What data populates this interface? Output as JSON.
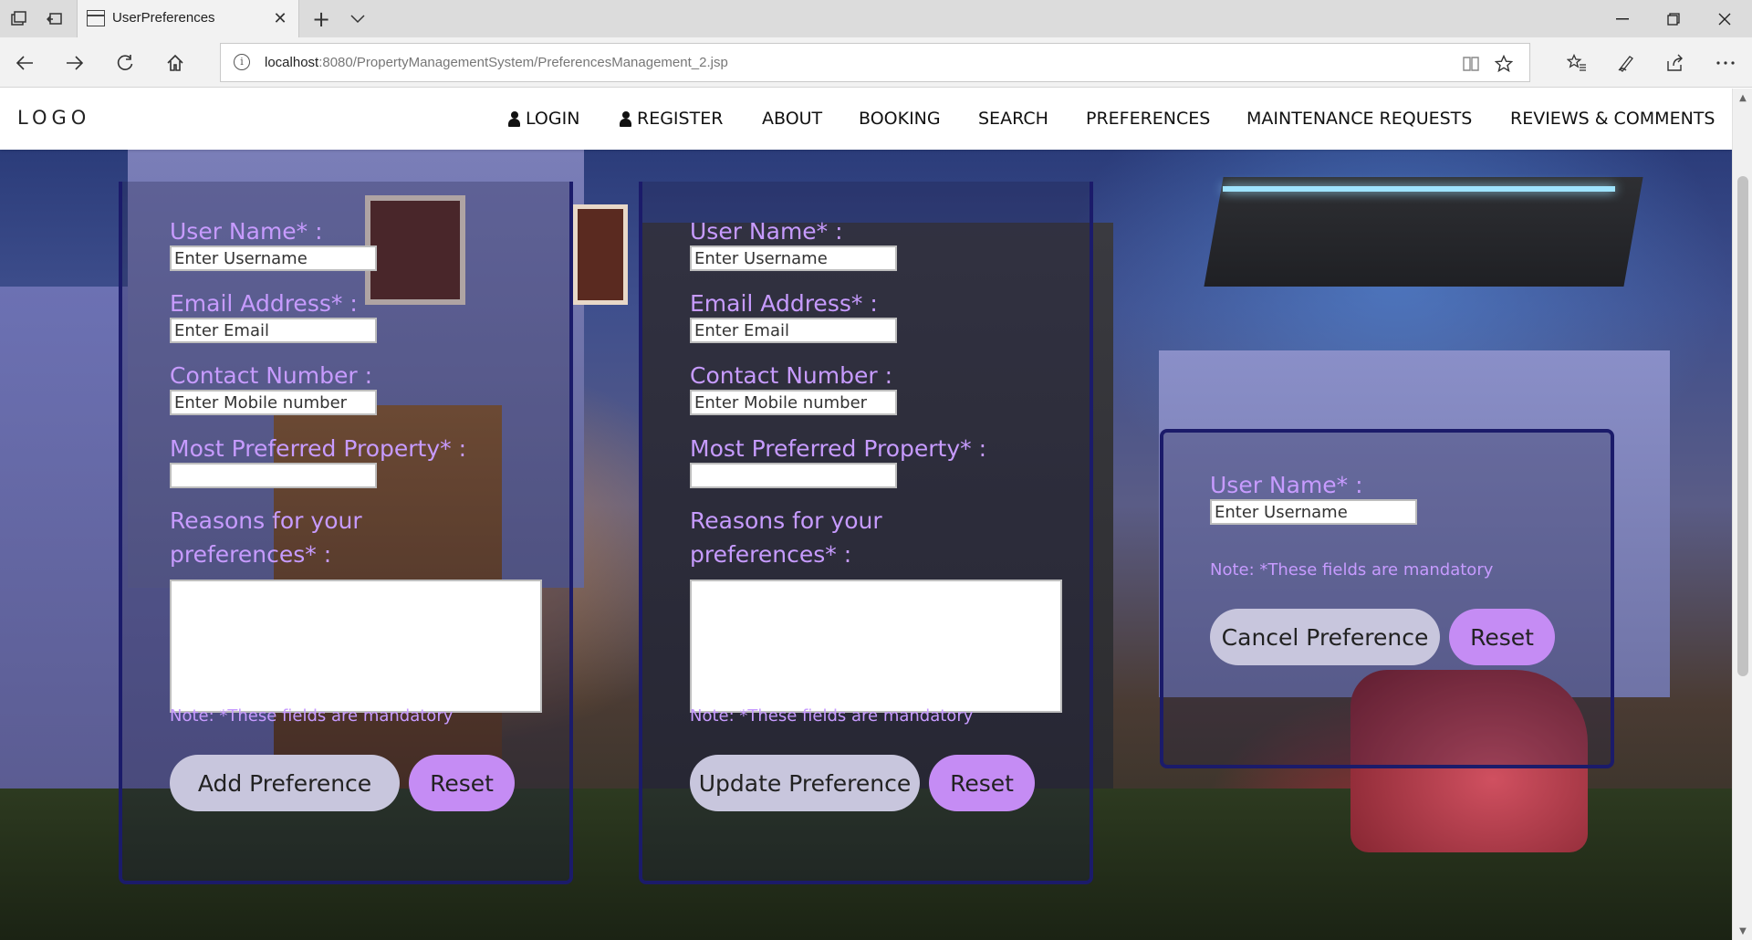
{
  "browser": {
    "tab_title": "UserPreferences",
    "url_host": "localhost",
    "url_rest": ":8080/PropertyManagementSystem/PreferencesManagement_2.jsp"
  },
  "site": {
    "logo": "LOGO",
    "nav": [
      {
        "label": "LOGIN",
        "icon": "user-icon"
      },
      {
        "label": "REGISTER",
        "icon": "user-icon"
      },
      {
        "label": "ABOUT"
      },
      {
        "label": "BOOKING"
      },
      {
        "label": "SEARCH"
      },
      {
        "label": "PREFERENCES"
      },
      {
        "label": "MAINTENANCE REQUESTS"
      },
      {
        "label": "REVIEWS & COMMENTS"
      }
    ]
  },
  "add_form": {
    "username_label": "User Name* :",
    "username_placeholder": "Enter Username",
    "email_label": "Email Address* :",
    "email_placeholder": "Enter Email",
    "contact_label": "Contact Number :",
    "contact_placeholder": "Enter Mobile number",
    "property_label": "Most Preferred Property* :",
    "property_value": "",
    "reasons_label": "Reasons for your preferences* :",
    "note": "Note: *These fields are mandatory",
    "submit_label": "Add Preference",
    "reset_label": "Reset"
  },
  "update_form": {
    "username_label": "User Name* :",
    "username_placeholder": "Enter Username",
    "email_label": "Email Address* :",
    "email_placeholder": "Enter Email",
    "contact_label": "Contact Number :",
    "contact_placeholder": "Enter Mobile number",
    "property_label": "Most Preferred Property* :",
    "property_value": "",
    "reasons_label": "Reasons for your preferences* :",
    "note": "Note: *These fields are mandatory",
    "submit_label": "Update Preference",
    "reset_label": "Reset"
  },
  "cancel_form": {
    "username_label": "User Name* :",
    "username_placeholder": "Enter Username",
    "note": "Note: *These fields are mandatory",
    "submit_label": "Cancel Preference",
    "reset_label": "Reset"
  },
  "colors": {
    "label": "#c79bff",
    "panel_border": "#1b1b6a",
    "button_main": "#c8c6dd",
    "button_reset": "#c58cf4"
  }
}
